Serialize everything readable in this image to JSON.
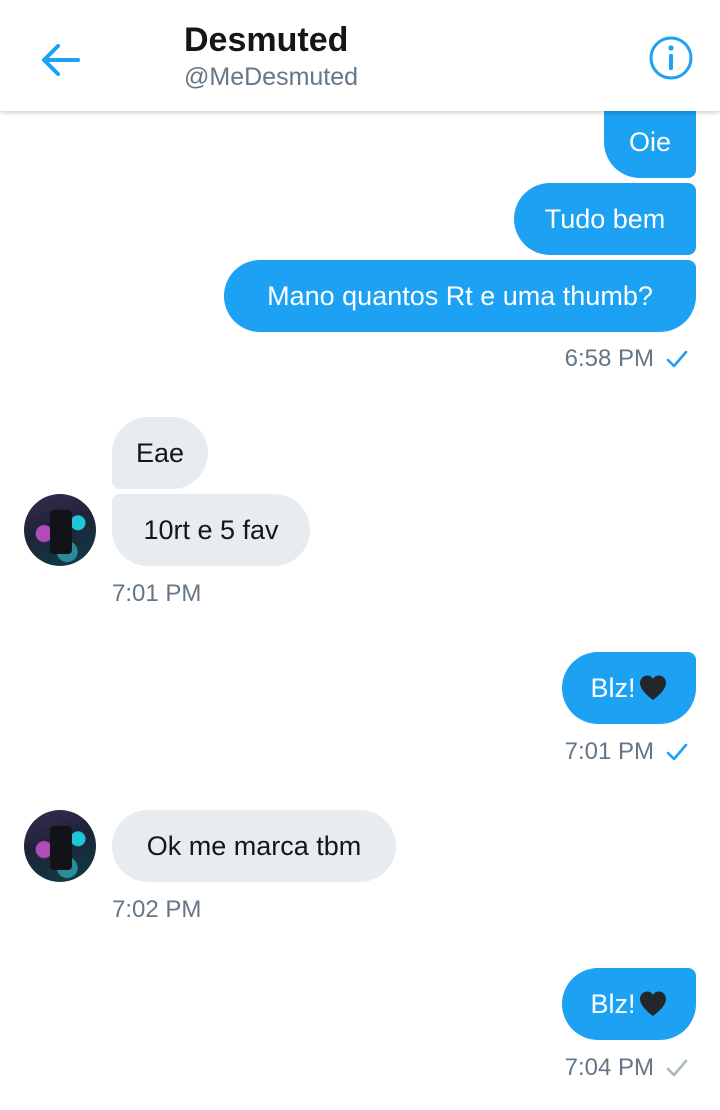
{
  "header": {
    "name": "Desmuted",
    "handle": "@MeDesmuted"
  },
  "messages": {
    "m1": "Oie",
    "m2": "Tudo bem",
    "m3": "Mano quantos Rt e uma thumb?",
    "t1": "6:58 PM",
    "m4": "Eae",
    "m5": "10rt e 5 fav",
    "t2": "7:01 PM",
    "m6": "Blz!",
    "t3": "7:01 PM",
    "m7": "Ok me marca tbm",
    "t4": "7:02 PM",
    "m8": "Blz!",
    "t5": "7:04 PM"
  },
  "colors": {
    "accent": "#1da1f2",
    "incoming_bubble": "#e6ecf0",
    "timestamp": "#657786",
    "check_unread": "#aab8c2"
  },
  "icons": {
    "back": "arrow-left-icon",
    "info": "info-circle-icon",
    "read_check": "check-icon",
    "heart": "black-heart-emoji"
  }
}
